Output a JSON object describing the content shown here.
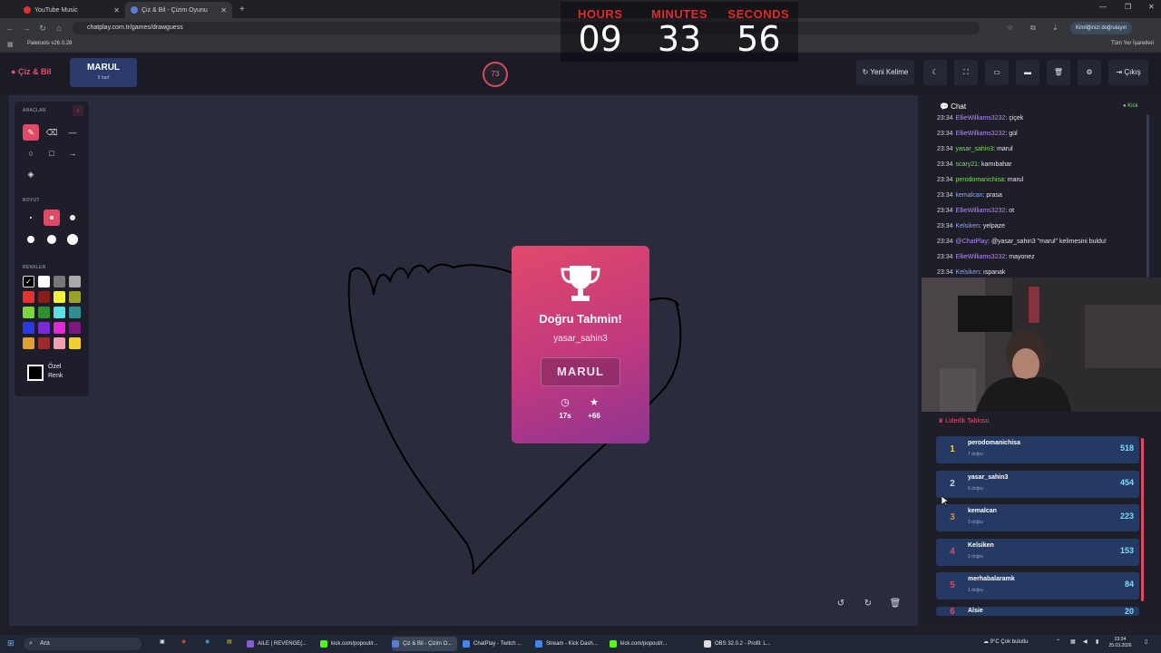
{
  "browser": {
    "tabs": [
      {
        "label": "YouTube Music",
        "icon": "youtube-music-icon",
        "color": "#e0312f",
        "active": false
      },
      {
        "label": "Çiz & Bil - Çizim Oyunu",
        "icon": "chatplay-icon",
        "color": "#5a7bd6",
        "active": true
      }
    ],
    "url": "chatplay.com.tr/games/drawguess",
    "identity_label": "Kimliğinizi doğrulayın",
    "bookmark": "Paletools v26.0.28",
    "all_bookmarks": "Tüm Yer İşaretleri"
  },
  "timer": {
    "hours_label": "HOURS",
    "hours": "09",
    "minutes_label": "MINUTES",
    "minutes": "33",
    "seconds_label": "SECONDS",
    "seconds": "56"
  },
  "header": {
    "logo": "Çiz & Bil",
    "word": "MARUL",
    "word_hint": "5 harf",
    "countdown": "73",
    "new_word_label": "Yeni Kelime",
    "exit_label": "Çıkış"
  },
  "tools": {
    "tools_label": "ARAÇLAR",
    "size_label": "BOYUT",
    "colors_label": "RENKLER",
    "custom_color_label": "Özel Renk",
    "colors": [
      "#000000",
      "#ffffff",
      "#777777",
      "#aaaaaa",
      "#e53030",
      "#8a1c1c",
      "#f2f23a",
      "#9aa02a",
      "#7ad63a",
      "#2f8f2f",
      "#5ae0e0",
      "#2f8f8f",
      "#2a3ae0",
      "#7a2ad6",
      "#e02ad6",
      "#7a1a7a",
      "#e0a030",
      "#a02a2a",
      "#f0a0b0",
      "#f0d030"
    ]
  },
  "result": {
    "title": "Doğru Tahmin!",
    "player": "yasar_sahin3",
    "word": "MARUL",
    "time": "17s",
    "points": "+66"
  },
  "chat": {
    "title": "Chat",
    "source": "Kick",
    "messages": [
      {
        "time": "23:34",
        "user": "EllieWilliams3232",
        "text": "çiçek",
        "color": "#b58aff"
      },
      {
        "time": "23:34",
        "user": "EllieWilliams3232",
        "text": "gül",
        "color": "#b58aff"
      },
      {
        "time": "23:34",
        "user": "yasar_sahin3",
        "text": "marul",
        "color": "#7fdc5a"
      },
      {
        "time": "23:34",
        "user": "scary21",
        "text": "karnıbahar",
        "color": "#7fdc5a"
      },
      {
        "time": "23:34",
        "user": "perodomanichisa",
        "text": "marul",
        "color": "#7fdc5a"
      },
      {
        "time": "23:34",
        "user": "kemalcan",
        "text": "prasa",
        "color": "#8fa8ff"
      },
      {
        "time": "23:34",
        "user": "EllieWilliams3232",
        "text": "ot",
        "color": "#b58aff"
      },
      {
        "time": "23:34",
        "user": "Kelsiken",
        "text": "yelpaze",
        "color": "#8fa8ff"
      },
      {
        "time": "23:34",
        "user": "@ChatPlay",
        "text": "@yasar_sahin3 \"marul\" kelimesini buldu!",
        "color": "#b58aff"
      },
      {
        "time": "23:34",
        "user": "EllieWilliams3232",
        "text": "mayonez",
        "color": "#b58aff"
      },
      {
        "time": "23:34",
        "user": "Kelsiken",
        "text": "ıspanak",
        "color": "#8fa8ff"
      }
    ]
  },
  "leaderboard": {
    "title": "Liderlik Tablosu",
    "rows": [
      {
        "rank": "1",
        "name": "perodomanichisa",
        "sub": "7 doğru",
        "score": "518",
        "rank_color": "#f2d03a"
      },
      {
        "rank": "2",
        "name": "yasar_sahin3",
        "sub": "6 doğru",
        "score": "454",
        "rank_color": "#cfd6e2"
      },
      {
        "rank": "3",
        "name": "kemalcan",
        "sub": "3 doğru",
        "score": "223",
        "rank_color": "#e08a3a"
      },
      {
        "rank": "4",
        "name": "Kelsiken",
        "sub": "2 doğru",
        "score": "153",
        "rank_color": "#e04a64"
      },
      {
        "rank": "5",
        "name": "merhabalaramk",
        "sub": "1 doğru",
        "score": "84",
        "rank_color": "#e04a64"
      },
      {
        "rank": "6",
        "name": "Alsie",
        "sub": "",
        "score": "20",
        "rank_color": "#e04a64"
      }
    ]
  },
  "taskbar": {
    "search": "Ara",
    "apps": [
      {
        "label": "AILE | REVENGE(...",
        "color": "#8a5bd6"
      },
      {
        "label": "kick.com/popout/r...",
        "color": "#53fc18"
      },
      {
        "label": "Çiz & Bil - Çizim O...",
        "color": "#5a7bd6"
      },
      {
        "label": "ChatPlay - Twitch ...",
        "color": "#4285f4"
      },
      {
        "label": "Stream - Kick Dash...",
        "color": "#4285f4"
      },
      {
        "label": "kick.com/popout/r...",
        "color": "#53fc18"
      },
      {
        "label": "OBS 32.0.2 - Profil: L...",
        "color": "#dddddd"
      }
    ],
    "weather": "9°C  Çok bulutlu",
    "time": "23:34",
    "date": "25.03.2026"
  }
}
